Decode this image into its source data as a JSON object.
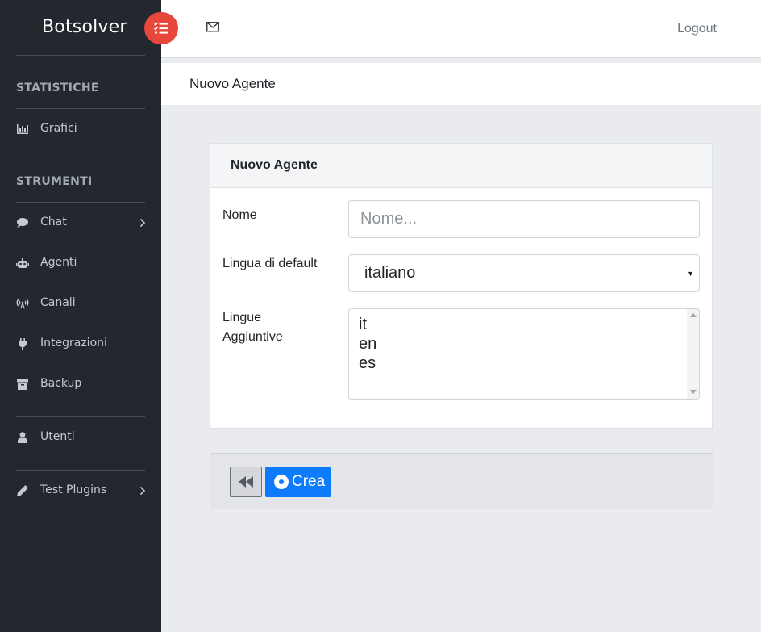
{
  "brand": {
    "name": "Botsolver"
  },
  "header": {
    "logout_label": "Logout",
    "mail_icon": "envelope-icon",
    "toggle_icon": "list-check-icon"
  },
  "sidebar": {
    "sections": [
      {
        "title": "STATISTICHE",
        "items": [
          {
            "label": "Grafici",
            "icon": "bar-chart-icon"
          }
        ]
      },
      {
        "title": "STRUMENTI",
        "items": [
          {
            "label": "Chat",
            "icon": "chat-icon",
            "expandable": true
          },
          {
            "label": "Agenti",
            "icon": "robot-icon"
          },
          {
            "label": "Canali",
            "icon": "broadcast-icon"
          },
          {
            "label": "Integrazioni",
            "icon": "plug-icon"
          },
          {
            "label": "Backup",
            "icon": "archive-icon"
          }
        ]
      }
    ],
    "extra_items": [
      {
        "label": "Utenti",
        "icon": "user-icon"
      },
      {
        "label": "Test Plugins",
        "icon": "pencil-icon",
        "expandable": true
      }
    ]
  },
  "page": {
    "title": "Nuovo Agente"
  },
  "form": {
    "card_title": "Nuovo Agente",
    "name_label": "Nome",
    "name_placeholder": "Nome...",
    "name_value": "",
    "default_language_label": "Lingua di default",
    "default_language_value": "italiano",
    "additional_languages_label_line1": "Lingue",
    "additional_languages_label_line2": "Aggiuntive",
    "additional_languages_options": [
      "it",
      "en",
      "es"
    ]
  },
  "actions": {
    "back_icon": "backward-icon",
    "create_label": "Crea",
    "create_icon": "dot-circle-icon"
  },
  "colors": {
    "sidebar_bg": "#23282e",
    "accent_red": "#e8473c",
    "primary_blue": "#0d7bfd",
    "content_bg": "#e9ebef"
  }
}
